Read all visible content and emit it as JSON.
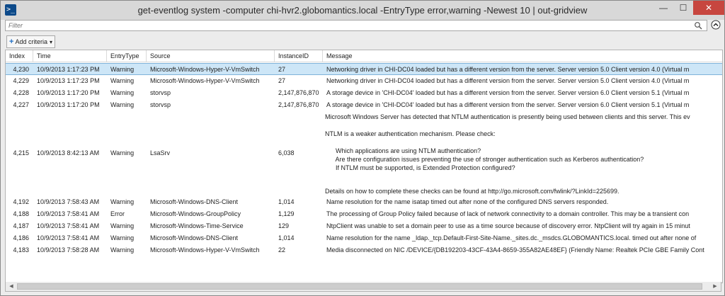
{
  "window": {
    "title": "get-eventlog system -computer chi-hvr2.globomantics.local -EntryType error,warning -Newest 10 | out-gridview",
    "app_icon_glyph": ">_",
    "minimize": "—",
    "maximize": "☐",
    "close": "✕"
  },
  "filter": {
    "placeholder": "Filter",
    "value": ""
  },
  "criteria": {
    "label": "Add criteria",
    "plus": "+",
    "caret": "▾"
  },
  "columns": [
    "Index",
    "Time",
    "EntryType",
    "Source",
    "InstanceID",
    "Message"
  ],
  "rows": [
    {
      "index": "4,230",
      "time": "10/9/2013 1:17:23 PM",
      "type": "Warning",
      "source": "Microsoft-Windows-Hyper-V-VmSwitch",
      "id": "27",
      "message": "Networking driver in CHI-DC04 loaded but has a different version from the server. Server version 5.0  Client version 4.0 (Virtual m",
      "selected": true
    },
    {
      "index": "4,229",
      "time": "10/9/2013 1:17:23 PM",
      "type": "Warning",
      "source": "Microsoft-Windows-Hyper-V-VmSwitch",
      "id": "27",
      "message": "Networking driver in CHI-DC04 loaded but has a different version from the server. Server version 5.0  Client version 4.0 (Virtual m"
    },
    {
      "index": "4,228",
      "time": "10/9/2013 1:17:20 PM",
      "type": "Warning",
      "source": "storvsp",
      "id": "2,147,876,870",
      "message": "A storage device in 'CHI-DC04' loaded but has a different version from the server.  Server version 6.0  Client version 5.1 (Virtual m"
    },
    {
      "index": "4,227",
      "time": "10/9/2013 1:17:20 PM",
      "type": "Warning",
      "source": "storvsp",
      "id": "2,147,876,870",
      "message": "A storage device in 'CHI-DC04' loaded but has a different version from the server.  Server version 6.0  Client version 5.1 (Virtual m"
    },
    {
      "index": "4,215",
      "time": "10/9/2013 8:42:13 AM",
      "type": "Warning",
      "source": "LsaSrv",
      "id": "6,038",
      "message_lines": [
        "Microsoft Windows Server has detected that NTLM authentication is presently being used between clients and this server. This ev",
        "",
        "NTLM is a weaker authentication mechanism. Please check:",
        "",
        "      Which applications are using NTLM authentication?",
        "      Are there configuration issues preventing the use of stronger authentication such as Kerberos authentication?",
        "      If NTLM must be supported, is Extended Protection configured?",
        "",
        "",
        "Details on how to complete these checks can be found at http://go.microsoft.com/fwlink/?LinkId=225699."
      ]
    },
    {
      "index": "4,192",
      "time": "10/9/2013 7:58:43 AM",
      "type": "Warning",
      "source": "Microsoft-Windows-DNS-Client",
      "id": "1,014",
      "message": "Name resolution for the name isatap timed out after none of the configured DNS servers responded."
    },
    {
      "index": "4,188",
      "time": "10/9/2013 7:58:41 AM",
      "type": "Error",
      "source": "Microsoft-Windows-GroupPolicy",
      "id": "1,129",
      "message": "The processing of Group Policy failed because of lack of network connectivity to a domain controller. This may be a transient con"
    },
    {
      "index": "4,187",
      "time": "10/9/2013 7:58:41 AM",
      "type": "Warning",
      "source": "Microsoft-Windows-Time-Service",
      "id": "129",
      "message": "NtpClient was unable to set a domain peer to use as a time source because of discovery error. NtpClient will try again in 15 minut"
    },
    {
      "index": "4,186",
      "time": "10/9/2013 7:58:41 AM",
      "type": "Warning",
      "source": "Microsoft-Windows-DNS-Client",
      "id": "1,014",
      "message": "Name resolution for the name _ldap._tcp.Default-First-Site-Name._sites.dc._msdcs.GLOBOMANTICS.local. timed out after none of"
    },
    {
      "index": "4,183",
      "time": "10/9/2013 7:58:28 AM",
      "type": "Warning",
      "source": "Microsoft-Windows-Hyper-V-VmSwitch",
      "id": "22",
      "message": "Media disconnected on NIC /DEVICE/{DB192203-43CF-43A4-8659-355A82AE48EF} (Friendly Name: Realtek PCIe GBE Family Cont"
    }
  ],
  "scrollbar": {
    "left_arrow": "◀",
    "right_arrow": "▶"
  },
  "colors": {
    "selection": "#cde6f7",
    "close_button": "#c7463f",
    "accent": "#1f6fc5"
  }
}
